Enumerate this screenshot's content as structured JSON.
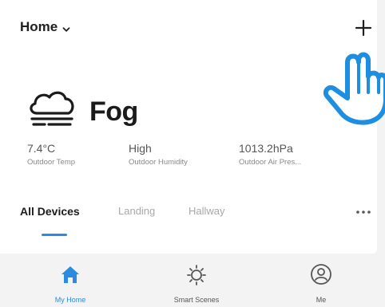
{
  "header": {
    "home_label": "Home",
    "add_icon": "plus-icon",
    "chevron_icon": "chevron-down-icon"
  },
  "pointer": {
    "icon": "pointing-hand-icon",
    "color": "#1e8fe0"
  },
  "weather": {
    "icon": "fog-icon",
    "condition": "Fog",
    "stats": [
      {
        "value": "7.4°C",
        "label": "Outdoor Temp"
      },
      {
        "value": "High",
        "label": "Outdoor Humidity"
      },
      {
        "value": "1013.2hPa",
        "label": "Outdoor Air Pres..."
      }
    ]
  },
  "tabs": {
    "items": [
      {
        "label": "All Devices",
        "active": true
      },
      {
        "label": "Landing",
        "active": false
      },
      {
        "label": "Hallway",
        "active": false
      }
    ],
    "more_icon": "more-dots-icon"
  },
  "bottom_nav": [
    {
      "label": "My Home",
      "icon": "home-icon",
      "active": true
    },
    {
      "label": "Smart Scenes",
      "icon": "sun-icon",
      "active": false
    },
    {
      "label": "Me",
      "icon": "profile-icon",
      "active": false
    }
  ],
  "colors": {
    "accent": "#2b8be0",
    "background": "#f3f3f3",
    "card": "#ffffff"
  }
}
